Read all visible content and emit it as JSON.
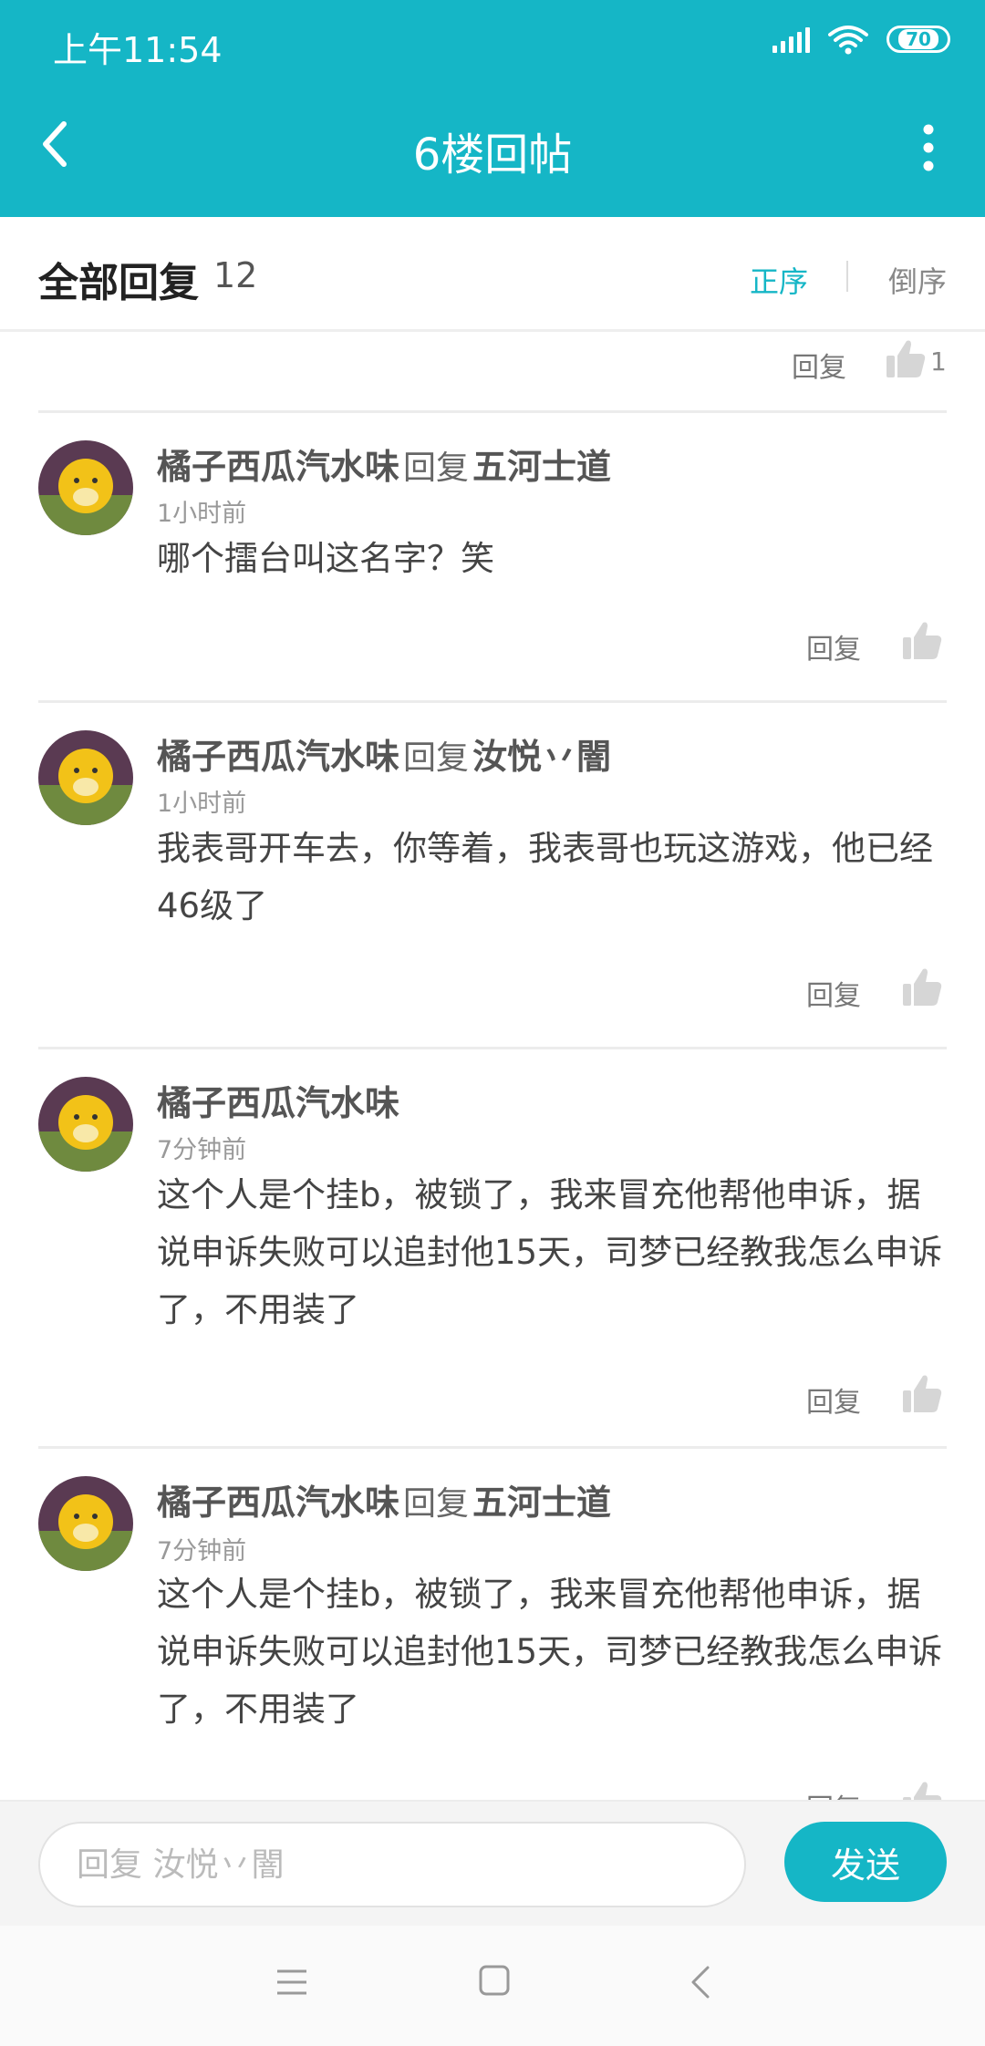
{
  "status_bar": {
    "time": "上午11:54",
    "battery": "70"
  },
  "header": {
    "title": "6楼回帖"
  },
  "sort_bar": {
    "title": "全部回复",
    "count": "12",
    "asc_label": "正序",
    "desc_label": "倒序"
  },
  "prev_item": {
    "reply_label": "回复",
    "like_count": "1"
  },
  "comments": [
    {
      "name": "橘子西瓜汽水味",
      "mid": "回复",
      "target": "五河士道",
      "time": "1小时前",
      "content": "哪个擂台叫这名字？笑",
      "reply_label": "回复"
    },
    {
      "name": "橘子西瓜汽水味",
      "mid": "回复",
      "target": "汝悦丷闇",
      "time": "1小时前",
      "content": "我表哥开车去，你等着，我表哥也玩这游戏，他已经46级了",
      "reply_label": "回复"
    },
    {
      "name": "橘子西瓜汽水味",
      "mid": "",
      "target": "",
      "time": "7分钟前",
      "content": "这个人是个挂b，被锁了，我来冒充他帮他申诉，据说申诉失败可以追封他15天，司梦已经教我怎么申诉了，不用装了",
      "reply_label": "回复"
    },
    {
      "name": "橘子西瓜汽水味",
      "mid": "回复",
      "target": "五河士道",
      "time": "7分钟前",
      "content": "这个人是个挂b，被锁了，我来冒充他帮他申诉，据说申诉失败可以追封他15天，司梦已经教我怎么申诉了，不用装了",
      "reply_label": "回复"
    }
  ],
  "input_bar": {
    "placeholder": "回复 汝悦丷闇",
    "send_label": "发送"
  },
  "colors": {
    "accent": "#15b6c6",
    "text": "#444444",
    "muted": "#999999"
  },
  "icons": [
    "back-arrow-icon",
    "more-vert-icon",
    "thumb-up-icon",
    "menu-icon",
    "home-icon",
    "back-icon",
    "signal-icon",
    "wifi-icon",
    "battery-icon"
  ]
}
